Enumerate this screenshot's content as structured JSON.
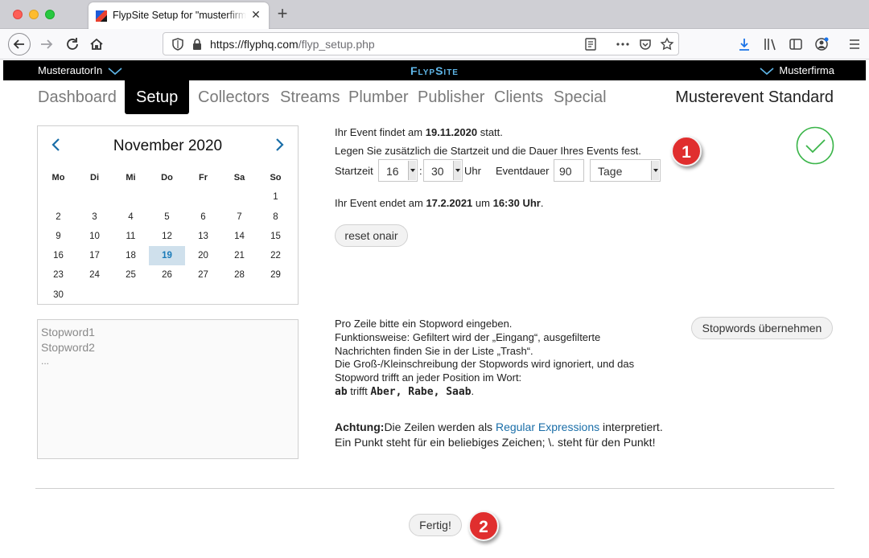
{
  "browser": {
    "tab_title": "FlypSite Setup for \"musterfirma\"",
    "url_host": "https://flyphq.com",
    "url_path": "/flyp_setup.php",
    "new_tab_symbol": "+",
    "close_symbol": "✕"
  },
  "appbar": {
    "author": "MusterautorIn",
    "brand": "FlypSite",
    "company": "Musterfirma"
  },
  "nav": {
    "items": [
      "Dashboard",
      "Setup",
      "Collectors",
      "Streams",
      "Plumber",
      "Publisher",
      "Clients",
      "Special"
    ],
    "active": "Setup",
    "event_title": "Musterevent Standard"
  },
  "calendar": {
    "month_label": "November 2020",
    "weekdays": [
      "Mo",
      "Di",
      "Mi",
      "Do",
      "Fr",
      "Sa",
      "So"
    ],
    "weeks": [
      [
        "",
        "",
        "",
        "",
        "",
        "",
        "1"
      ],
      [
        "2",
        "3",
        "4",
        "5",
        "6",
        "7",
        "8"
      ],
      [
        "9",
        "10",
        "11",
        "12",
        "13",
        "14",
        "15"
      ],
      [
        "16",
        "17",
        "18",
        "19",
        "20",
        "21",
        "22"
      ],
      [
        "23",
        "24",
        "25",
        "26",
        "27",
        "28",
        "29"
      ],
      [
        "30",
        "",
        "",
        "",
        "",
        "",
        ""
      ]
    ],
    "selected_day": "19"
  },
  "event": {
    "line1_prefix": "Ihr Event findet am ",
    "line1_date": "19.11.2020",
    "line1_suffix": " statt.",
    "line2": "Legen Sie zusätzlich die Startzeit und die Dauer Ihres Events fest.",
    "start_label": "Startzeit",
    "start_hour": "16",
    "time_sep": ":",
    "start_minute": "30",
    "hour_unit": "Uhr",
    "duration_label": "Eventdauer",
    "duration_value": "90",
    "duration_unit": "Tage",
    "end_prefix": "Ihr Event endet am ",
    "end_date": "17.2.2021",
    "end_mid": " um ",
    "end_time": "16:30 Uhr",
    "end_suffix": ".",
    "reset_label": "reset onair",
    "badge1": "1"
  },
  "stopwords": {
    "textarea_lines": [
      "Stopword1",
      "Stopword2",
      "..."
    ],
    "help_lines": [
      "Pro Zeile bitte ein Stopword eingeben.",
      "Funktionsweise: Gefiltert wird der „Eingang“, ausgefilterte",
      "Nachrichten finden Sie in der Liste „Trash“.",
      "Die Groß-/Kleinschreibung der Stopwords wird ignoriert, und das",
      "Stopword trifft an jeder Position im Wort:"
    ],
    "example_word": "ab",
    "example_mid": " trifft ",
    "example_matches": "Aber, Rabe, Saab",
    "example_end": ".",
    "note_bold": "Achtung:",
    "note_part1": "Die Zeilen werden als ",
    "note_link": "Regular Expressions",
    "note_part2": "interpretiert. Ein Punkt steht für ein beliebiges Zeichen; \\. steht für den Punkt!",
    "apply_label": "Stopwords übernehmen"
  },
  "footer": {
    "done_label": "Fertig!",
    "badge2": "2"
  },
  "colors": {
    "accent_blue": "#1a6ea8",
    "badge_red": "#e02e2e",
    "check_green": "#3bb54a"
  }
}
